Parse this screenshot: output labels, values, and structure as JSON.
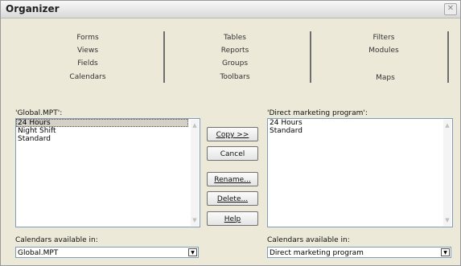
{
  "window": {
    "title": "Organizer",
    "close_glyph": "✕"
  },
  "tabs": {
    "col1": [
      "Forms",
      "Views",
      "Fields",
      "Calendars"
    ],
    "col2": [
      "Tables",
      "Reports",
      "Groups",
      "Toolbars"
    ],
    "col3a": [
      "Filters",
      "Modules"
    ],
    "col3b": "Maps",
    "active": "Calendars"
  },
  "left": {
    "label": "'Global.MPT':",
    "items": [
      "24 Hours",
      "Night Shift",
      "Standard"
    ],
    "selected": "24 Hours",
    "avail_label": "Calendars available in:",
    "avail_value": "Global.MPT"
  },
  "right": {
    "label": "'Direct marketing program':",
    "items": [
      "24 Hours",
      "Standard"
    ],
    "avail_label": "Calendars available in:",
    "avail_value": "Direct marketing program"
  },
  "buttons": {
    "copy": "Copy >>",
    "cancel": "Cancel",
    "rename": "Rename...",
    "delete": "Delete...",
    "help": "Help"
  },
  "icons": {
    "scroll_up": "▲",
    "scroll_down": "▼",
    "dropdown": "▼"
  }
}
